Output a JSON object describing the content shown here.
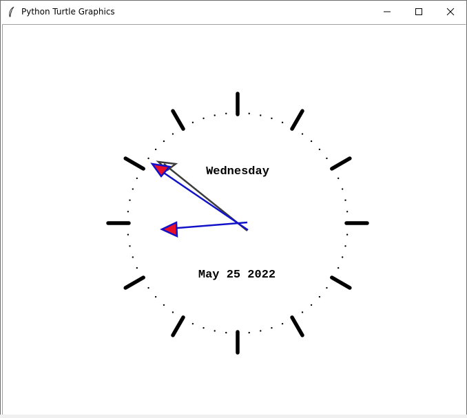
{
  "window": {
    "title": "Python Turtle Graphics"
  },
  "clock": {
    "day": "Wednesday",
    "date": "May 25 2022",
    "hour_hand_color": "#1212c8",
    "minute_hand_color": "#1212c8",
    "second_hand_color": "#3c3c3c",
    "arrow_fill": "#e8102a",
    "tick_color": "#000000"
  },
  "icons": {
    "app": "feather-icon",
    "minimize": "minimize-icon",
    "maximize": "maximize-icon",
    "close": "close-icon"
  }
}
